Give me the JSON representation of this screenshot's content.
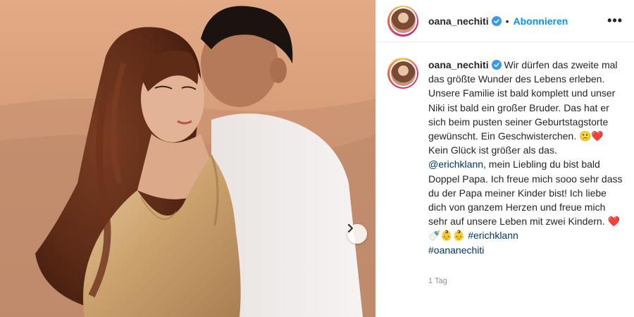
{
  "post": {
    "username": "oana_nechiti",
    "follow_label": "Abonnieren",
    "separator": "•",
    "more_label": "•••",
    "caption": {
      "line1": "Wir dürfen das zweite mal das größte Wunder des Lebens erleben. Unsere Familie ist bald komplett und unser Niki ist bald ein großer Bruder. Das hat er sich beim pusten seiner Geburtstagstorte gewünscht. Ein Geschwisterchen.",
      "emoji1": "🙁❤️",
      "line2": "Kein Glück ist größer als das.",
      "mention": "@erichklann",
      "line3": ", mein Liebling du bist bald Doppel Papa. Ich freue mich sooo sehr dass du der Papa meiner Kinder bist! Ich liebe dich von ganzem Herzen und freue mich sehr auf unsere Leben mit zwei Kindern.",
      "emoji2": "❤️🍼👶👶",
      "hashtag1": "#erichklann",
      "hashtag2": "#oananechiti"
    },
    "timestamp": "1 Tag"
  },
  "icons": {
    "verified": "verified-badge-icon",
    "next": "chevron-right-icon",
    "more": "more-options-icon"
  },
  "colors": {
    "accent": "#0095f6",
    "link": "#00376b",
    "verified": "#3897f0"
  }
}
